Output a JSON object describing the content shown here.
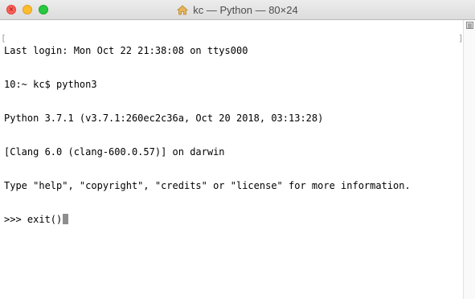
{
  "window": {
    "title": "kc — Python — 80×24",
    "title_icon": "home-folder-icon",
    "controls": {
      "close": "close-icon",
      "minimize": "minimize-icon",
      "zoom": "zoom-icon"
    }
  },
  "terminal": {
    "lines": [
      "Last login: Mon Oct 22 21:38:08 on ttys000",
      "10:~ kc$ python3",
      "Python 3.7.1 (v3.7.1:260ec2c36a, Oct 20 2018, 03:13:28)",
      "[Clang 6.0 (clang-600.0.57)] on darwin",
      "Type \"help\", \"copyright\", \"credits\" or \"license\" for more information.",
      ">>> exit()"
    ],
    "cursor": "block-cursor",
    "bracket_left": "[",
    "bracket_right": "]"
  },
  "scrollbar": {
    "marker_icon": "scroll-marker-icon"
  },
  "colors": {
    "close": "#fc5f57",
    "minimize": "#fdbc2e",
    "zoom": "#28c840",
    "text": "#000000",
    "cursor": "#8e8e8e"
  }
}
